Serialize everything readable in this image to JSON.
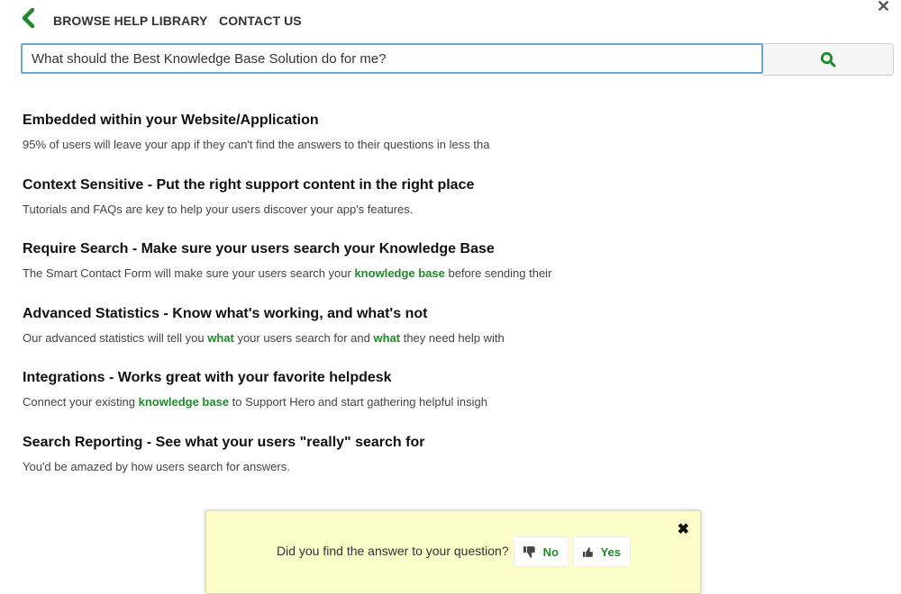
{
  "nav": {
    "back_icon": "chevron-left-icon",
    "browse_label": "BROWSE HELP LIBRARY",
    "contact_label": "CONTACT US",
    "close_icon": "close-icon"
  },
  "search": {
    "value": "What should the Best Knowledge Base Solution do for me?",
    "button_icon": "search-icon"
  },
  "results": [
    {
      "title": "Embedded within your Website/Application",
      "snippet": [
        {
          "t": "95% of users will leave your app if they can't find the answers to their questions in less tha"
        }
      ]
    },
    {
      "title": "Context Sensitive - Put the right support content in the right place",
      "snippet": [
        {
          "t": "Tutorials and FAQs are key to help your users discover your app's features."
        }
      ]
    },
    {
      "title": "Require Search - Make sure your users search your Knowledge Base",
      "snippet": [
        {
          "t": "The Smart Contact Form will make sure your users search your "
        },
        {
          "t": "knowledge base",
          "hl": true
        },
        {
          "t": " before sending their"
        }
      ]
    },
    {
      "title": "Advanced Statistics - Know what's working, and what's not",
      "snippet": [
        {
          "t": "Our advanced statistics will tell you "
        },
        {
          "t": "what",
          "hl": true
        },
        {
          "t": " your users search for and "
        },
        {
          "t": "what",
          "hl": true
        },
        {
          "t": " they need help with"
        }
      ]
    },
    {
      "title": "Integrations - Works great with your favorite helpdesk",
      "snippet": [
        {
          "t": "Connect your existing "
        },
        {
          "t": "knowledge base",
          "hl": true
        },
        {
          "t": " to Support Hero and start gathering helpful insigh"
        }
      ]
    },
    {
      "title": "Search Reporting - See what your users \"really\" search for",
      "snippet": [
        {
          "t": "You'd be amazed by how users search for answers."
        }
      ]
    }
  ],
  "feedback": {
    "question": "Did you find the answer to your question?",
    "no_label": "No",
    "yes_label": "Yes",
    "close_icon": "close-icon"
  },
  "colors": {
    "accent": "#1e8a2a",
    "feedback_bg": "#fdfdc9",
    "input_border": "#6aa7d6"
  }
}
